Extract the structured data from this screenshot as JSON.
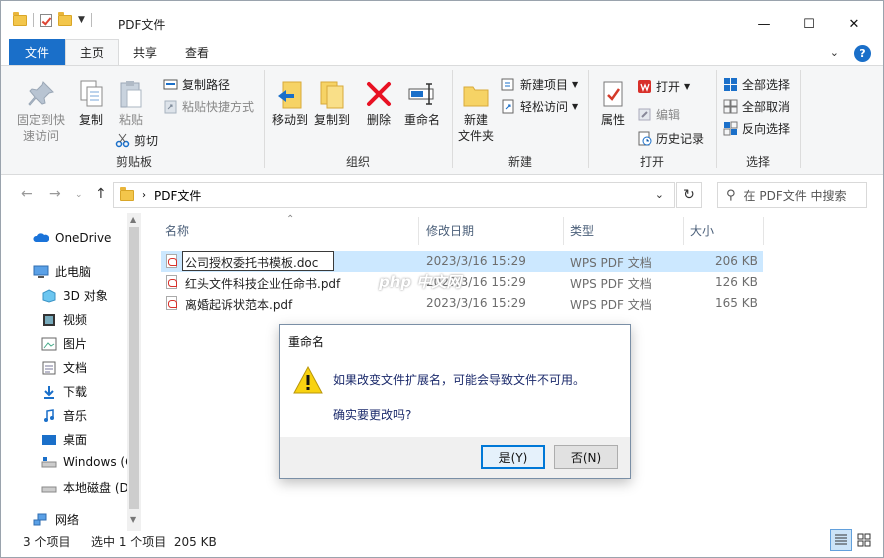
{
  "window": {
    "title": "PDF文件",
    "minimize": "—",
    "maximize": "☐",
    "close": "✕"
  },
  "tabs": [
    "文件",
    "主页",
    "共享",
    "查看"
  ],
  "help": "?",
  "ribbon": {
    "pin_label": "固定到快速访问",
    "pin_line1": "固定到快",
    "pin_line2": "速访问",
    "copy": "复制",
    "paste": "粘贴",
    "copy_path": "复制路径",
    "paste_shortcut": "粘贴快捷方式",
    "cut": "剪切",
    "clipboard": "剪贴板",
    "move_to": "移动到",
    "copy_to": "复制到",
    "delete": "删除",
    "rename": "重命名",
    "organize": "组织",
    "new_folder_line1": "新建",
    "new_folder_line2": "文件夹",
    "new_item": "新建项目",
    "easy_access": "轻松访问",
    "new": "新建",
    "properties": "属性",
    "open": "打开",
    "edit": "编辑",
    "history": "历史记录",
    "open_group": "打开",
    "select_all": "全部选择",
    "select_none": "全部取消",
    "invert": "反向选择",
    "select_group": "选择"
  },
  "nav": {
    "path": "PDF文件",
    "search_placeholder": "在 PDF文件 中搜索"
  },
  "sidebar": {
    "items": [
      {
        "label": "OneDrive",
        "icon": "cloud-icon"
      },
      {
        "label": "此电脑",
        "icon": "computer-icon"
      },
      {
        "label": "3D 对象",
        "icon": "cube-icon"
      },
      {
        "label": "视频",
        "icon": "video-icon"
      },
      {
        "label": "图片",
        "icon": "picture-icon"
      },
      {
        "label": "文档",
        "icon": "document-icon"
      },
      {
        "label": "下载",
        "icon": "download-icon"
      },
      {
        "label": "音乐",
        "icon": "music-icon"
      },
      {
        "label": "桌面",
        "icon": "desktop-icon"
      },
      {
        "label": "Windows (C",
        "icon": "drive-icon"
      },
      {
        "label": "本地磁盘 (D",
        "icon": "disk-icon"
      },
      {
        "label": "网络",
        "icon": "network-icon"
      }
    ]
  },
  "columns": {
    "name": "名称",
    "date": "修改日期",
    "type": "类型",
    "size": "大小"
  },
  "files": [
    {
      "name": "公司授权委托书模板.doc",
      "date": "2023/3/16 15:29",
      "type": "WPS PDF 文档",
      "size": "206 KB"
    },
    {
      "name": "红头文件科技企业任命书.pdf",
      "date": "2023/3/16 15:29",
      "type": "WPS PDF 文档",
      "size": "126 KB"
    },
    {
      "name": "离婚起诉状范本.pdf",
      "date": "2023/3/16 15:29",
      "type": "WPS PDF 文档",
      "size": "165 KB"
    }
  ],
  "dialog": {
    "title": "重命名",
    "message": "如果改变文件扩展名，可能会导致文件不可用。",
    "question": "确实要更改吗?",
    "yes": "是(Y)",
    "no": "否(N)"
  },
  "status": {
    "count": "3 个项目",
    "selected": "选中 1 个项目  205 KB"
  },
  "watermark": "php 中文网"
}
